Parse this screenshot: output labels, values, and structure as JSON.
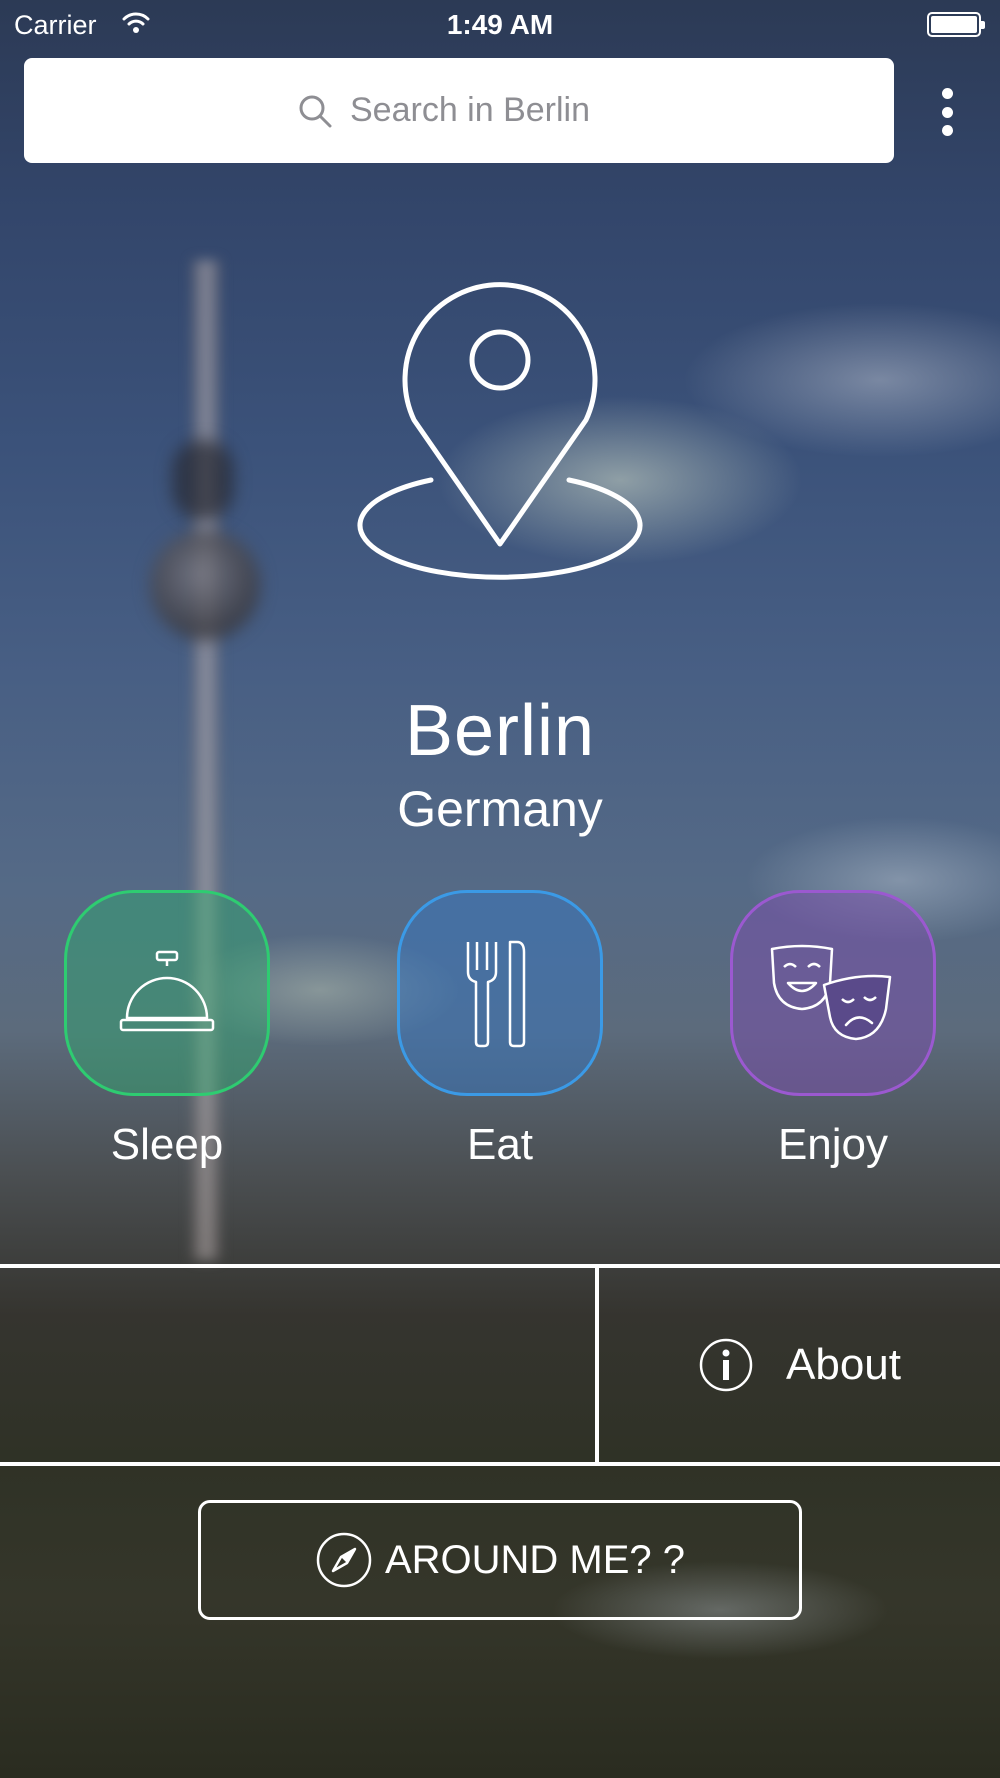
{
  "status_bar": {
    "carrier": "Carrier",
    "time": "1:49 AM"
  },
  "search": {
    "placeholder": "Search in Berlin"
  },
  "hero": {
    "city": "Berlin",
    "country": "Germany",
    "logo_icon": "map-pin-icon"
  },
  "categories": [
    {
      "label": "Sleep",
      "icon": "hotel-bell-icon",
      "color": "#2ecc71"
    },
    {
      "label": "Eat",
      "icon": "fork-knife-icon",
      "color": "#3b9ae6"
    },
    {
      "label": "Enjoy",
      "icon": "theater-masks-icon",
      "color": "#9b59d0"
    }
  ],
  "about": {
    "label": "About",
    "icon": "info-icon"
  },
  "around_me": {
    "label": "AROUND ME? ?",
    "icon": "compass-icon"
  }
}
